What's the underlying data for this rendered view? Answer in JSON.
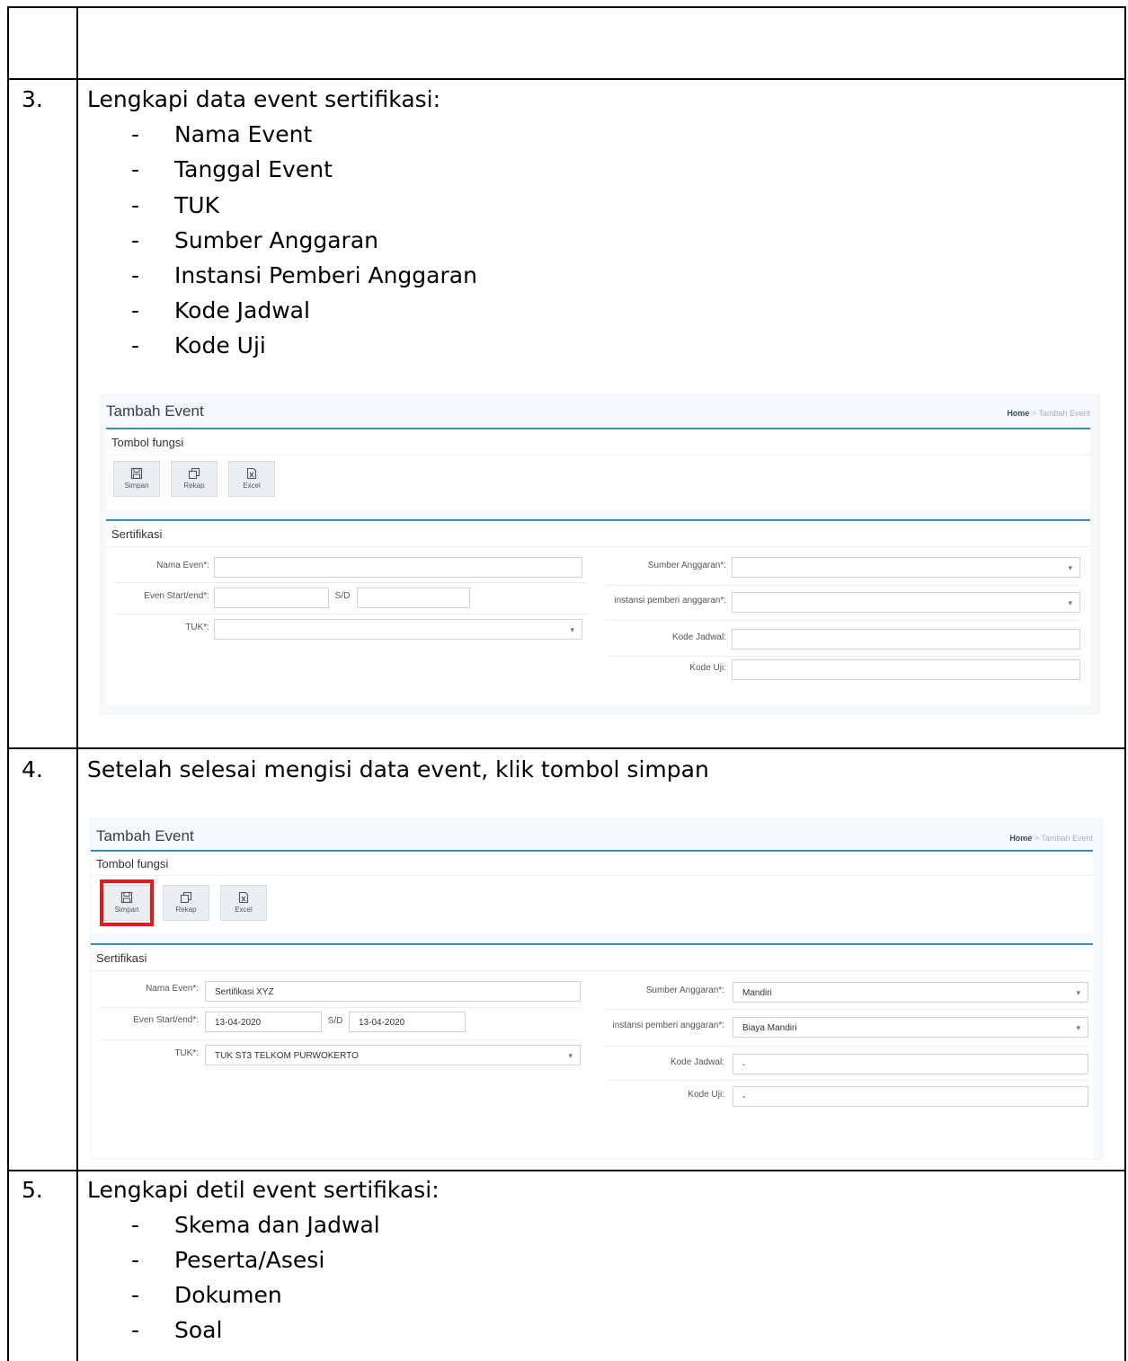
{
  "steps": [
    {
      "number": "3.",
      "title": "Lengkapi data event sertifikasi:",
      "items": [
        "Nama Event",
        "Tanggal Event",
        "TUK",
        "Sumber Anggaran",
        "Instansi Pemberi Anggaran",
        "Kode Jadwal",
        "Kode Uji"
      ]
    },
    {
      "number": "4.",
      "title": "Setelah selesai mengisi data event, klik tombol simpan"
    },
    {
      "number": "5.",
      "title": "Lengkapi detil event sertifikasi:",
      "items": [
        "Skema dan Jadwal",
        "Peserta/Asesi",
        "Dokumen",
        "Soal"
      ]
    }
  ],
  "bullet_marker": "-",
  "app": {
    "page_title": "Tambah Event",
    "breadcrumb": {
      "home": "Home",
      "separator": ">",
      "current": "Tambah Event"
    },
    "function_panel_title": "Tombol fungsi",
    "buttons": {
      "save": "Simpan",
      "recap": "Rekap",
      "excel": "Excel"
    },
    "form_panel_title": "Sertifikasi",
    "labels": {
      "event_name": "Nama Even*:",
      "event_dates": "Even Start/end*:",
      "date_separator": "S/D",
      "tuk": "TUK*:",
      "budget_source": "Sumber Anggaran*:",
      "budget_agency": "instansi pemberi anggaran*:",
      "schedule_code": "Kode Jadwal:",
      "test_code": "Kode Uji:"
    },
    "accent_color": "#3c8dbc",
    "highlight_color": "#e01b1b"
  },
  "filled_form": {
    "event_name": "Sertifikasi XYZ",
    "start_date": "13-04-2020",
    "end_date": "13-04-2020",
    "tuk": "TUK ST3 TELKOM PURWOKERTO",
    "budget_source": "Mandiri",
    "budget_agency": "Biaya Mandiri",
    "schedule_code": "-",
    "test_code": "-"
  }
}
